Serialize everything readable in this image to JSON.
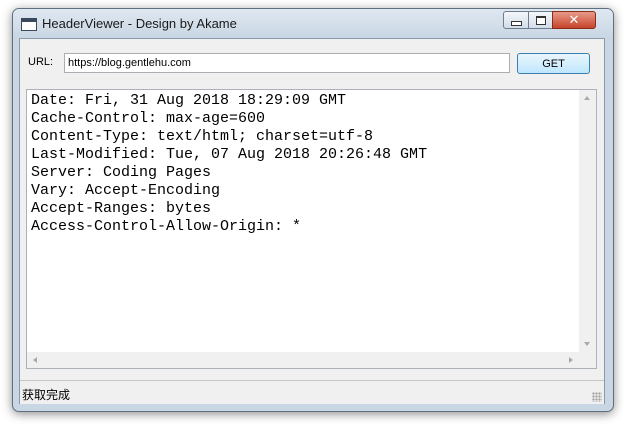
{
  "window": {
    "title": "HeaderViewer - Design by Akame",
    "controls": {
      "minimize": "",
      "maximize": "",
      "close": "✕"
    }
  },
  "toolbar": {
    "url_label": "URL:",
    "url_value": "https://blog.gentlehu.com",
    "get_label": "GET"
  },
  "output": {
    "lines": [
      "Date: Fri, 31 Aug 2018 18:29:09 GMT",
      "Cache-Control: max-age=600",
      "Content-Type: text/html; charset=utf-8",
      "Last-Modified: Tue, 07 Aug 2018 20:26:48 GMT",
      "Server: Coding Pages",
      "Vary: Accept-Encoding",
      "Accept-Ranges: bytes",
      "Access-Control-Allow-Origin: *"
    ]
  },
  "status": {
    "text": "获取完成"
  },
  "colors": {
    "title_bar": "#c9d6e3",
    "close_button": "#c5452a",
    "get_button_border": "#3c7fb1"
  }
}
